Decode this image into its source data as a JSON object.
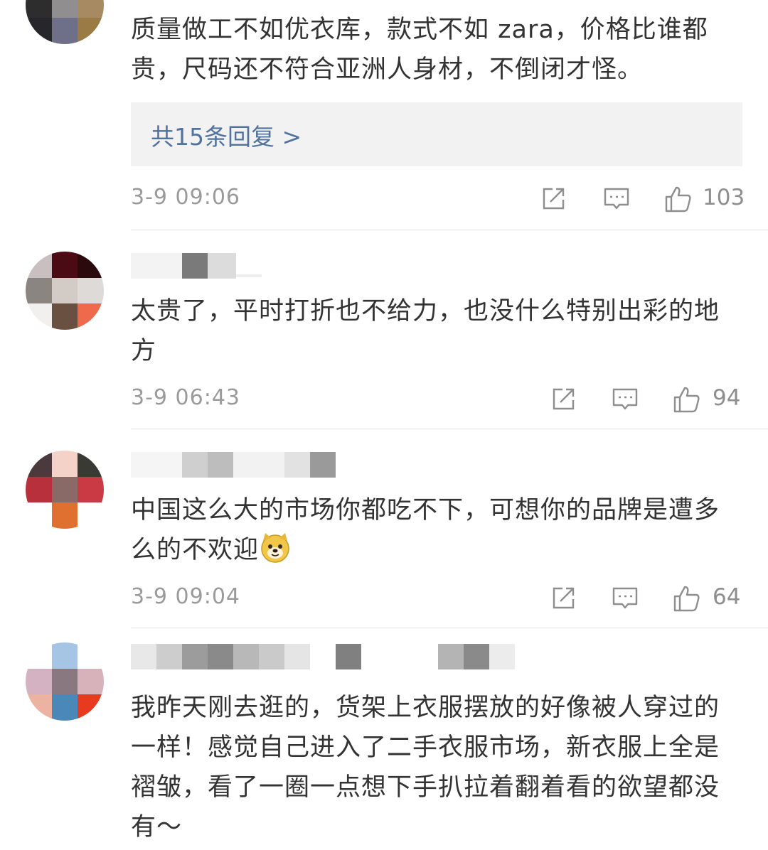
{
  "comments": [
    {
      "text": "质量做工不如优衣库，款式不如 zara，价格比谁都贵，尺码还不符合亚洲人身材，不倒闭才怪。",
      "reply_summary": "共15条回复 >",
      "time": "3-9 09:06",
      "likes": "103"
    },
    {
      "text": "太贵了，平时打折也不给力，也没什么特别出彩的地方",
      "time": "3-9 06:43",
      "likes": "94"
    },
    {
      "text": "中国这么大的市场你都吃不下，可想你的品牌是遭多么的不欢迎",
      "time": "3-9 09:04",
      "likes": "64"
    },
    {
      "text": "我昨天刚去逛的，货架上衣服摆放的好像被人穿过的一样！感觉自己进入了二手衣服市场，新衣服上全是褶皱，看了一圈一点想下手扒拉着翻着看的欲望都没有～"
    }
  ],
  "icons": {
    "share": "share-icon",
    "comment": "comment-icon",
    "like": "thumbs-up-icon",
    "emoji": "doge-emoji-icon"
  },
  "colors": {
    "text": "#333333",
    "link": "#52729e",
    "meta": "#9a9a9a",
    "reply_bg": "#f2f2f2"
  }
}
